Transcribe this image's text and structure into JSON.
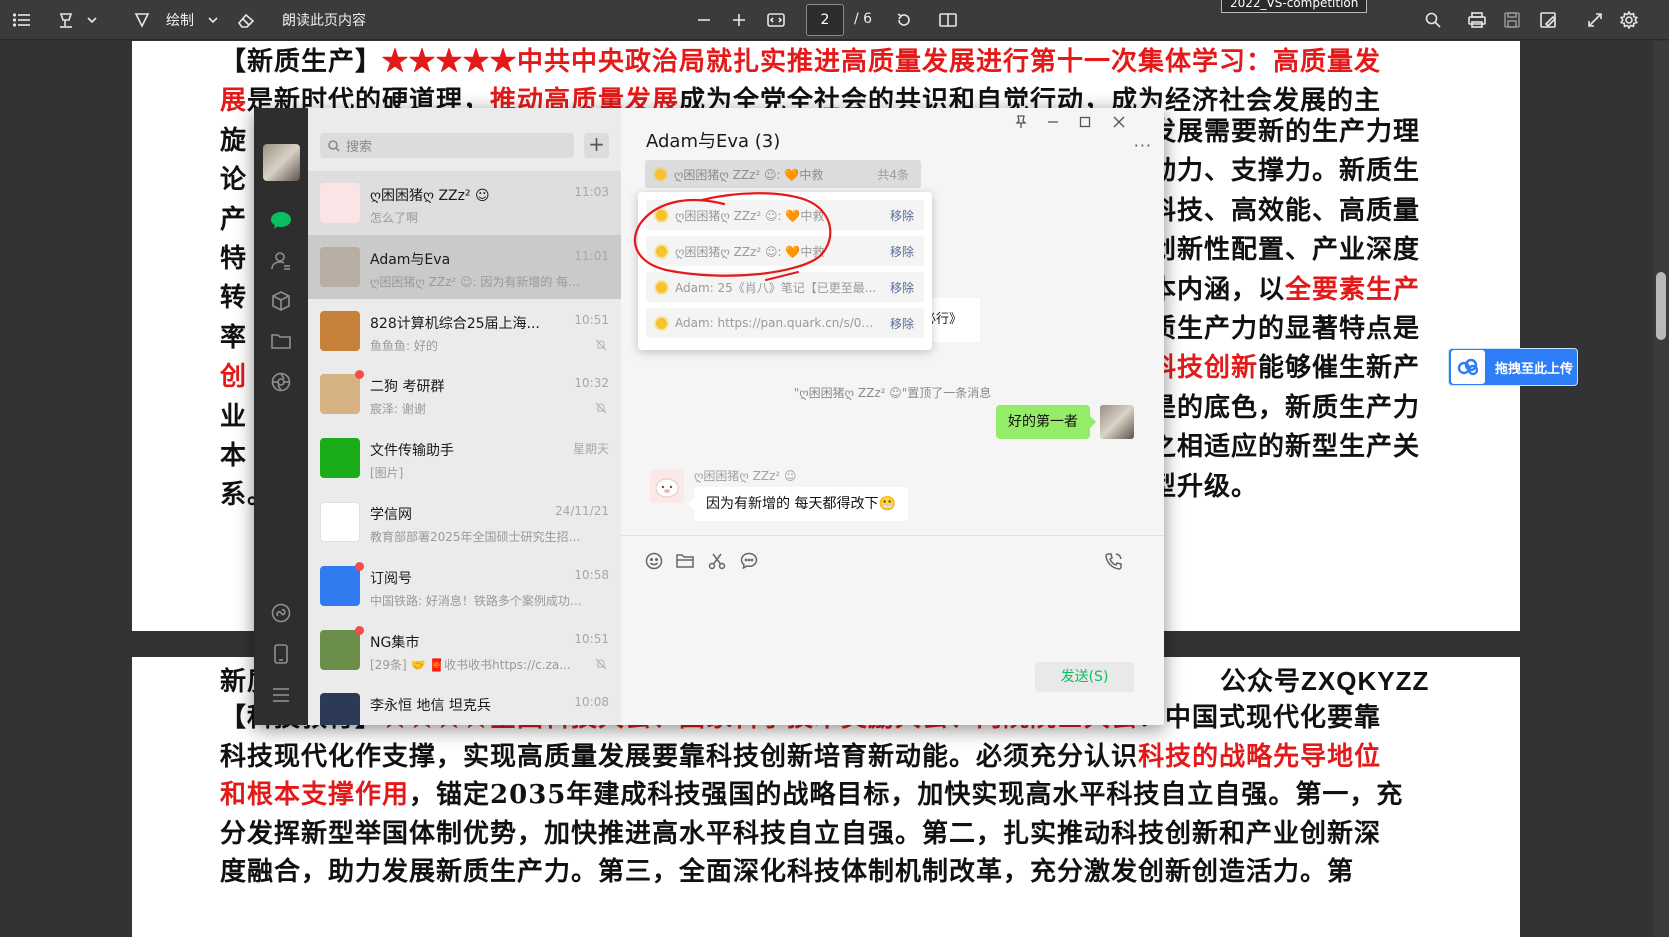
{
  "toolbar": {
    "draw_label": "绘制",
    "read_aloud_label": "朗读此页内容",
    "page_current": "2",
    "page_total": "/ 6",
    "tooltip": "2022_VS-competition"
  },
  "pdf": {
    "page1_lines": [
      [
        [
          "【新质生产】",
          ""
        ],
        [
          "★★★★★中共中央政治局就扎实推进高质量发展进行第十一次集体学习：高质量发",
          "red"
        ]
      ],
      [
        [
          "展",
          "red"
        ],
        [
          "是新时代的硬道理，",
          ""
        ],
        [
          "推动高质量发展",
          "red"
        ],
        [
          "成为全党全社会的共识和自觉行动，成为经济社会发展的主",
          ""
        ]
      ],
      [
        [
          "旋",
          ""
        ]
      ],
      [
        [
          "论",
          ""
        ]
      ],
      [
        [
          "产",
          ""
        ]
      ],
      [
        [
          "特",
          ""
        ]
      ],
      [
        [
          "转",
          ""
        ]
      ],
      [
        [
          "率",
          ""
        ]
      ],
      [
        [
          "创",
          "red"
        ]
      ],
      [
        [
          "业",
          ""
        ]
      ],
      [
        [
          "本",
          ""
        ]
      ],
      [
        [
          "系。",
          ""
        ]
      ]
    ],
    "page1_right_lines": [
      [
        [
          "发展需要新的生产力理",
          ""
        ]
      ],
      [
        [
          "动力、支撑力。新质生",
          ""
        ]
      ],
      [
        [
          "科技、高效能、高质量",
          ""
        ]
      ],
      [
        [
          "创新性配置、产业深度",
          ""
        ]
      ],
      [
        [
          "本内涵，以",
          ""
        ],
        [
          "全要素生产",
          "red"
        ]
      ],
      [
        [
          "质生产力的显著特点是",
          ""
        ]
      ],
      [
        [
          "科技创新",
          "red"
        ],
        [
          "能够催生新产",
          ""
        ]
      ],
      [
        [
          "是的底色，新质生产力",
          ""
        ]
      ],
      [
        [
          "之相适应的新型生产关",
          ""
        ]
      ],
      [
        [
          "型升级。",
          ""
        ]
      ]
    ],
    "page2_header_left": "新质",
    "page2_header_right": "公众号ZXQKYZZ",
    "page2_lines": [
      [
        [
          "【科技教育】",
          ""
        ],
        [
          "★★★★全国科技大会、国家科学技术奖励大会、两院院士大会",
          "red"
        ],
        [
          "：中国式现代化要靠",
          ""
        ]
      ],
      [
        [
          "科技现代化",
          ""
        ],
        [
          "作支撑，实现高质量发展要靠",
          ""
        ],
        [
          "科技创新",
          ""
        ],
        [
          "培育新动能。必须充分认识",
          ""
        ],
        [
          "科技的战略先导地位",
          "red"
        ]
      ],
      [
        [
          "和根本支撑作用",
          "red"
        ],
        [
          "，锚定2035年建成科技强国的战略目标，加快实现高水平科技自立自强。第一，",
          ""
        ],
        [
          "充",
          ""
        ]
      ],
      [
        [
          "分发挥新型举国体制优势",
          ""
        ],
        [
          "，加快推进高水平科技自立自强。第二，",
          ""
        ],
        [
          "扎实推动科技创新和产业创新深",
          ""
        ]
      ],
      [
        [
          "度融合",
          ""
        ],
        [
          "，助力发展新质生产力。第三，",
          ""
        ],
        [
          "全面深化科技体制机制改革",
          ""
        ],
        [
          "，充分激发创新创造活力。第",
          ""
        ]
      ]
    ]
  },
  "upload_button": "拖拽至此上传",
  "wechat": {
    "search_placeholder": "搜索",
    "add_label": "+",
    "chats": [
      {
        "name": "ღ困困猪ღ ZZz² ☺",
        "time": "11:03",
        "preview": "怎么了啊",
        "dot": false,
        "mute": false,
        "state": "pinned",
        "avatar": "#fbe4e6"
      },
      {
        "name": "Adam与Eva",
        "time": "11:01",
        "preview": "ღ困困猪ღ ZZz² ☺: 因为有新增的 每天...",
        "dot": false,
        "mute": false,
        "state": "active",
        "avatar": "#b8aea3"
      },
      {
        "name": "828计算机综合25届上海...",
        "time": "10:51",
        "preview": "鱼鱼鱼: 好的",
        "dot": false,
        "mute": true,
        "state": "",
        "avatar": "#c8813b"
      },
      {
        "name": "二狗 考研群",
        "time": "10:32",
        "preview": "宸泽: 谢谢",
        "dot": true,
        "mute": true,
        "state": "",
        "avatar": "#d7b383"
      },
      {
        "name": "文件传输助手",
        "time": "星期天",
        "preview": "[图片]",
        "dot": false,
        "mute": false,
        "state": "",
        "avatar": "#1aad19"
      },
      {
        "name": "学信网",
        "time": "24/11/21",
        "preview": "教育部部署2025年全国硕士研究生招生...",
        "dot": false,
        "mute": false,
        "state": "",
        "avatar": "#ffffff"
      },
      {
        "name": "订阅号",
        "time": "10:58",
        "preview": "中国铁路: 好消息！铁路多个案例成功入...",
        "dot": true,
        "mute": false,
        "state": "",
        "avatar": "#2f7bef"
      },
      {
        "name": "NG集市",
        "time": "10:51",
        "preview": "[29条] 🤝 🧧收书收书https://c.za...",
        "dot": true,
        "mute": true,
        "state": "",
        "avatar": "#6b8f4a"
      },
      {
        "name": "李永恒 地信 坦克兵",
        "time": "10:08",
        "preview": "",
        "dot": false,
        "mute": false,
        "state": "",
        "avatar": "#2c3a57"
      }
    ],
    "chat_title": "Adam与Eva (3)",
    "pin_bar_text": "ღ困困猪ღ ZZz² ☺: 🧡中救",
    "pin_bar_count": "共4条",
    "pinned_items": [
      {
        "text": "ღ困困猪ღ ZZz² ☺: 🧡中救",
        "remove": "移除"
      },
      {
        "text": "ღ困困猪ღ ZZz² ☺: 🧡中救",
        "remove": "移除"
      },
      {
        "text": "Adam: 25《肖八》笔记【已更至最...",
        "remove": "移除"
      },
      {
        "text": "Adam: https://pan.quark.cn/s/07e...",
        "remove": "移除"
      }
    ],
    "behind_fragment": "必行》",
    "system_note": "\"ღ困困猪ღ ZZz² ☺\"置顶了一条消息",
    "my_message": "好的第一者",
    "other_sender": "ღ困困猪ღ ZZz² ☺",
    "other_message": "因为有新增的 每天都得改下😬",
    "send_label": "发送(S)"
  },
  "colors": {
    "wechat_green": "#07c160",
    "bubble_green": "#95ec69",
    "annotation_red": "#e41a1a",
    "link_blue": "#576b95"
  }
}
